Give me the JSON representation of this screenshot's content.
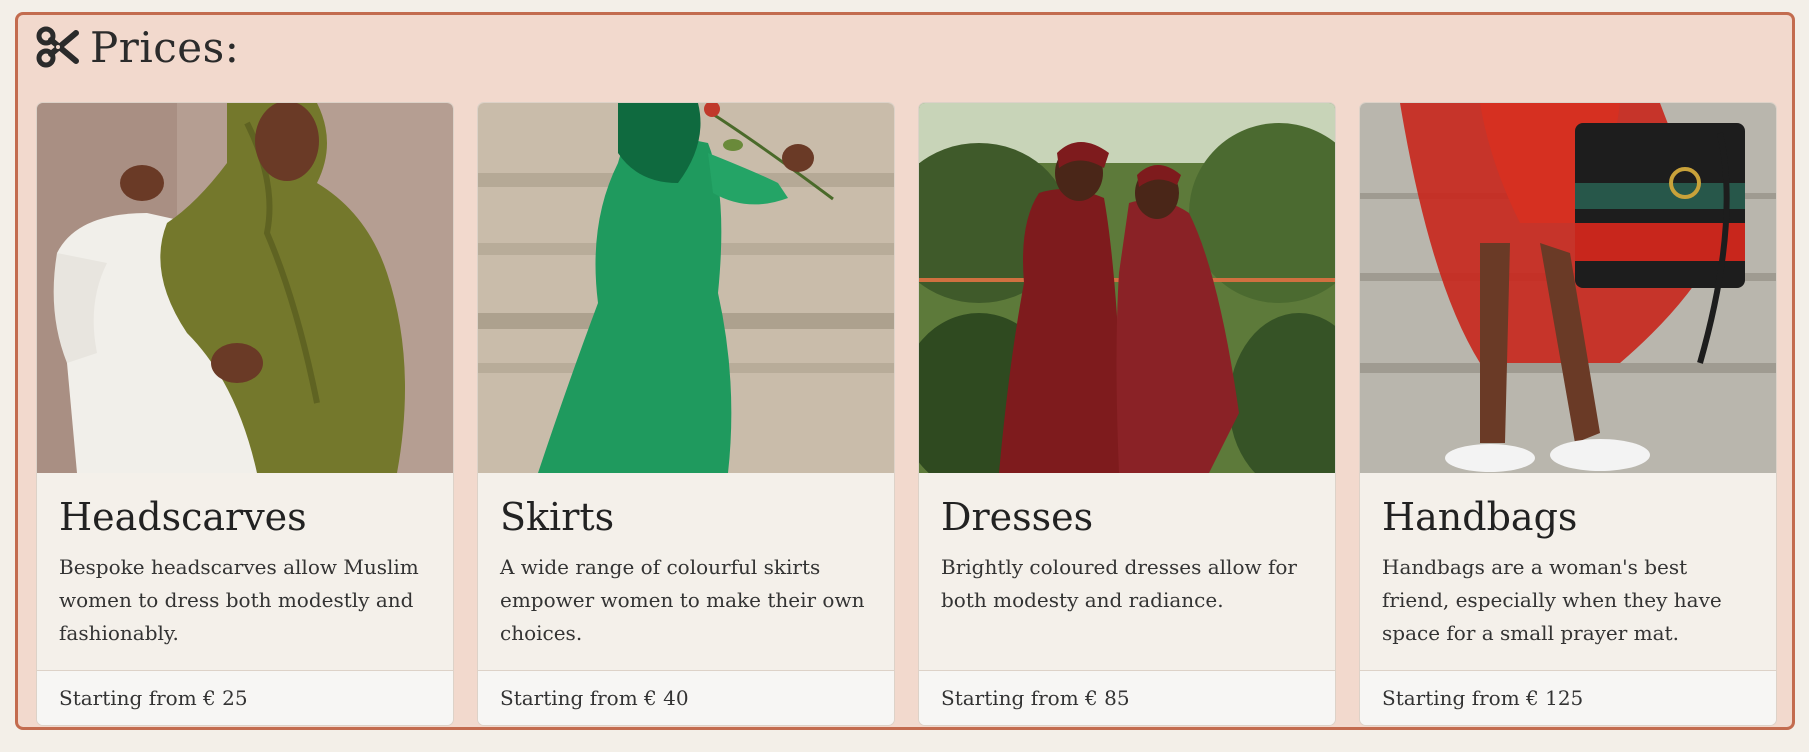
{
  "section": {
    "heading": "Prices:",
    "icon": "scissors-icon"
  },
  "cards": [
    {
      "title": "Headscarves",
      "description": "Bespoke headscarves allow Muslim women to dress both modestly and fashionably.",
      "price": "Starting from € 25",
      "image": "woman-olive-headscarf-photo"
    },
    {
      "title": "Skirts",
      "description": "A wide range of colourful skirts empower women to make their own choices.",
      "price": "Starting from € 40",
      "image": "woman-green-skirt-photo"
    },
    {
      "title": "Dresses",
      "description": "Brightly coloured dresses allow for both modesty and radiance.",
      "price": "Starting from € 85",
      "image": "two-women-red-dresses-photo"
    },
    {
      "title": "Handbags",
      "description": "Handbags are a woman's best friend, especially when they have space for a small prayer mat.",
      "price": "Starting from € 125",
      "image": "handbag-red-skirt-photo"
    }
  ],
  "colors": {
    "border": "#c36c4f",
    "panel_background": "#f2d9cd",
    "card_background": "#f4f0ea"
  }
}
